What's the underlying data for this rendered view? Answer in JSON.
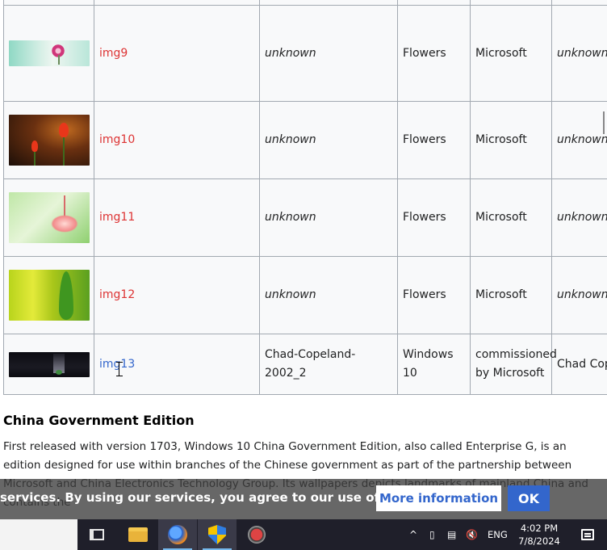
{
  "table": {
    "rows": [
      {
        "image_name": "img9",
        "link_color": "red",
        "author": "unknown",
        "category": "Flowers",
        "source": "Microsoft",
        "license": "unknown"
      },
      {
        "image_name": "img10",
        "link_color": "red",
        "author": "unknown",
        "category": "Flowers",
        "source": "Microsoft",
        "license": "unknown"
      },
      {
        "image_name": "img11",
        "link_color": "red",
        "author": "unknown",
        "category": "Flowers",
        "source": "Microsoft",
        "license": "unknown"
      },
      {
        "image_name": "img12",
        "link_color": "red",
        "author": "unknown",
        "category": "Flowers",
        "source": "Microsoft",
        "license": "unknown"
      },
      {
        "image_name": "img13",
        "link_color": "blue",
        "author": "Chad-Copeland-2002_2",
        "category": "Windows 10",
        "source": "commissioned by Microsoft",
        "license": "Chad Cop"
      }
    ]
  },
  "section": {
    "title": "China Government Edition",
    "paragraph": "First released with version 1703, Windows 10 China Government Edition, also called Enterprise G, is an edition designed for use within branches of the Chinese government as part of the partnership between Microsoft and China Electronics Technology Group. Its wallpapers depicts landmarks of mainland China and contains the"
  },
  "cookie_banner": {
    "text": "services. By using our services, you agree to our use of cookies.",
    "more_label": "More information",
    "ok_label": "OK"
  },
  "taskbar": {
    "apps": [
      "task-view",
      "file-explorer",
      "firefox",
      "security-shield",
      "app"
    ],
    "tray": {
      "chevron": "^",
      "language": "ENG"
    },
    "clock": {
      "time": "4:02 PM",
      "date": "7/8/2024"
    }
  },
  "colors": {
    "link_red": "#dd3333",
    "link_blue": "#3366cc",
    "table_bg": "#f8f9fa",
    "taskbar_bg": "#1f1f2a"
  }
}
